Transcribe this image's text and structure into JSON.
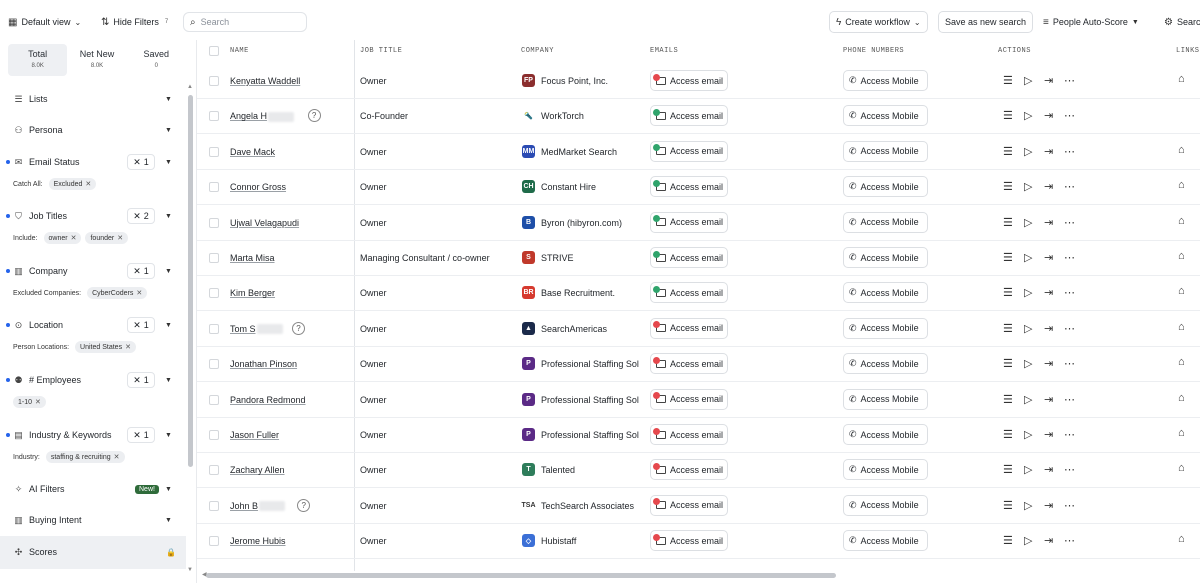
{
  "toolbar": {
    "default_view": "Default view",
    "hide_filters": "Hide Filters",
    "hide_filters_count": "7",
    "search_placeholder": "Search",
    "create_workflow": "Create workflow",
    "save_search": "Save as new search",
    "sort": "People Auto-Score",
    "settings": "Searc"
  },
  "sidebar": {
    "tabs": [
      {
        "label": "Total",
        "count": "8.0K"
      },
      {
        "label": "Net New",
        "count": "8.0K"
      },
      {
        "label": "Saved",
        "count": "0"
      }
    ],
    "filters": {
      "lists": {
        "label": "Lists"
      },
      "persona": {
        "label": "Persona"
      },
      "email_status": {
        "label": "Email Status",
        "count": "1",
        "sub_label": "Catch All:",
        "chips": [
          "Excluded"
        ]
      },
      "job_titles": {
        "label": "Job Titles",
        "count": "2",
        "sub_label": "Include:",
        "chips": [
          "owner",
          "founder"
        ]
      },
      "company": {
        "label": "Company",
        "count": "1",
        "sub_label": "Excluded Companies:",
        "chips": [
          "CyberCoders"
        ]
      },
      "location": {
        "label": "Location",
        "count": "1",
        "sub_label": "Person Locations:",
        "chips": [
          "United States"
        ]
      },
      "employees": {
        "label": "# Employees",
        "count": "1",
        "chips": [
          "1-10"
        ]
      },
      "industry": {
        "label": "Industry & Keywords",
        "count": "1",
        "sub_label": "Industry:",
        "chips": [
          "staffing & recruiting"
        ]
      },
      "ai_filters": {
        "label": "AI Filters",
        "badge": "New!"
      },
      "buying_intent": {
        "label": "Buying Intent"
      },
      "scores": {
        "label": "Scores"
      }
    }
  },
  "table": {
    "headers": {
      "name": "NAME",
      "job_title": "JOB TITLE",
      "company": "COMPANY",
      "emails": "EMAILS",
      "phone": "PHONE NUMBERS",
      "actions": "ACTIONS",
      "links": "LINKS"
    },
    "email_label": "Access email",
    "phone_label": "Access Mobile",
    "rows": [
      {
        "name": "Kenyatta Waddell",
        "title": "Owner",
        "company": "Focus Point, Inc.",
        "logo_text": "FP",
        "logo_color": "#8b2e2e",
        "email_status": "#e5484d",
        "links": true
      },
      {
        "name": "Angela H",
        "redacted": true,
        "title": "Co-Founder",
        "company": "WorkTorch",
        "logo_text": "🔦",
        "logo_color": "#ffffff",
        "email_status": "#30a46c",
        "links": false
      },
      {
        "name": "Dave Mack",
        "title": "Owner",
        "company": "MedMarket Search",
        "logo_text": "MM",
        "logo_color": "#2b4bb3",
        "email_status": "#30a46c",
        "links": true
      },
      {
        "name": "Connor Gross",
        "title": "Owner",
        "company": "Constant Hire",
        "logo_text": "CH",
        "logo_color": "#1f6b4a",
        "email_status": "#30a46c",
        "links": true
      },
      {
        "name": "Ujwal Velagapudi",
        "title": "Owner",
        "company": "Byron (hibyron.com)",
        "logo_text": "B",
        "logo_color": "#1e4fa8",
        "email_status": "#30a46c",
        "links": true
      },
      {
        "name": "Marta Misa",
        "title": "Managing Consultant / co-owner",
        "company": "STRIVE",
        "logo_text": "S",
        "logo_color": "#c0392b",
        "email_status": "#30a46c",
        "links": true
      },
      {
        "name": "Kim Berger",
        "title": "Owner",
        "company": "Base Recruitment.",
        "logo_text": "BR",
        "logo_color": "#d63a2f",
        "email_status": "#30a46c",
        "links": true
      },
      {
        "name": "Tom S",
        "redacted": true,
        "title": "Owner",
        "company": "SearchAmericas",
        "logo_text": "▲",
        "logo_color": "#1b2a4a",
        "email_status": "#e5484d",
        "links": true
      },
      {
        "name": "Jonathan Pinson",
        "title": "Owner",
        "company": "Professional Staffing Sol",
        "logo_text": "P",
        "logo_color": "#5b2a86",
        "email_status": "#e5484d",
        "links": true
      },
      {
        "name": "Pandora Redmond",
        "title": "Owner",
        "company": "Professional Staffing Sol",
        "logo_text": "P",
        "logo_color": "#5b2a86",
        "email_status": "#e5484d",
        "links": true
      },
      {
        "name": "Jason Fuller",
        "title": "Owner",
        "company": "Professional Staffing Sol",
        "logo_text": "P",
        "logo_color": "#5b2a86",
        "email_status": "#e5484d",
        "links": true
      },
      {
        "name": "Zachary Allen",
        "title": "Owner",
        "company": "Talented",
        "logo_text": "T",
        "logo_color": "#2e7d5b",
        "email_status": "#e5484d",
        "links": true
      },
      {
        "name": "John B",
        "redacted": true,
        "title": "Owner",
        "company": "TechSearch Associates",
        "logo_text": "TSA",
        "logo_color": "#ffffff",
        "email_status": "#e5484d",
        "links": false
      },
      {
        "name": "Jerome Hubis",
        "title": "Owner",
        "company": "Hubistaff",
        "logo_text": "◇",
        "logo_color": "#3b6fd6",
        "email_status": "#e5484d",
        "links": true
      }
    ]
  }
}
